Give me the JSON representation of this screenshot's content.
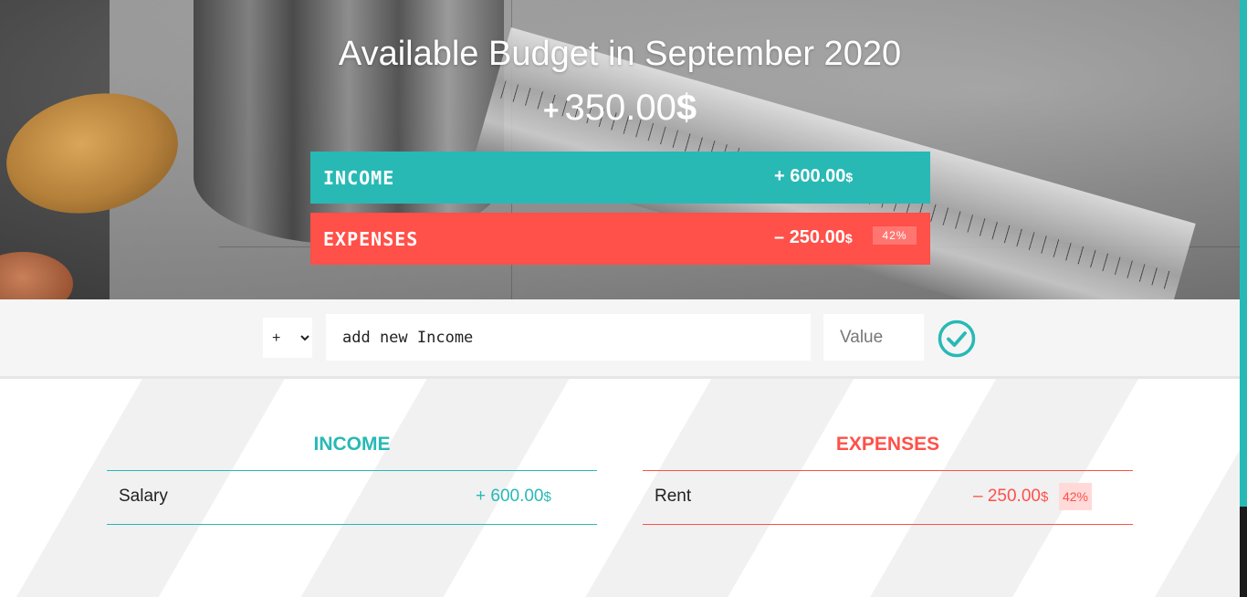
{
  "header": {
    "title": "Available Budget in September 2020",
    "budget_sign": "+",
    "budget_value": "350.00",
    "currency": "$"
  },
  "summary": {
    "income": {
      "label": "INCOME",
      "sign": "+",
      "value": "600.00",
      "currency": "$"
    },
    "expenses": {
      "label": "EXPENSES",
      "sign": "–",
      "value": "250.00",
      "currency": "$",
      "percentage": "42%"
    }
  },
  "add_form": {
    "type_value": "+",
    "description_placeholder": "add new Income",
    "value_placeholder": "Value"
  },
  "income_list": {
    "title": "INCOME",
    "items": [
      {
        "description": "Salary",
        "sign": "+",
        "value": "600.00",
        "currency": "$"
      }
    ]
  },
  "expenses_list": {
    "title": "EXPENSES",
    "items": [
      {
        "description": "Rent",
        "sign": "–",
        "value": "250.00",
        "currency": "$",
        "percentage": "42%"
      }
    ]
  },
  "colors": {
    "income": "#28b9b5",
    "expenses": "#ff5049"
  }
}
